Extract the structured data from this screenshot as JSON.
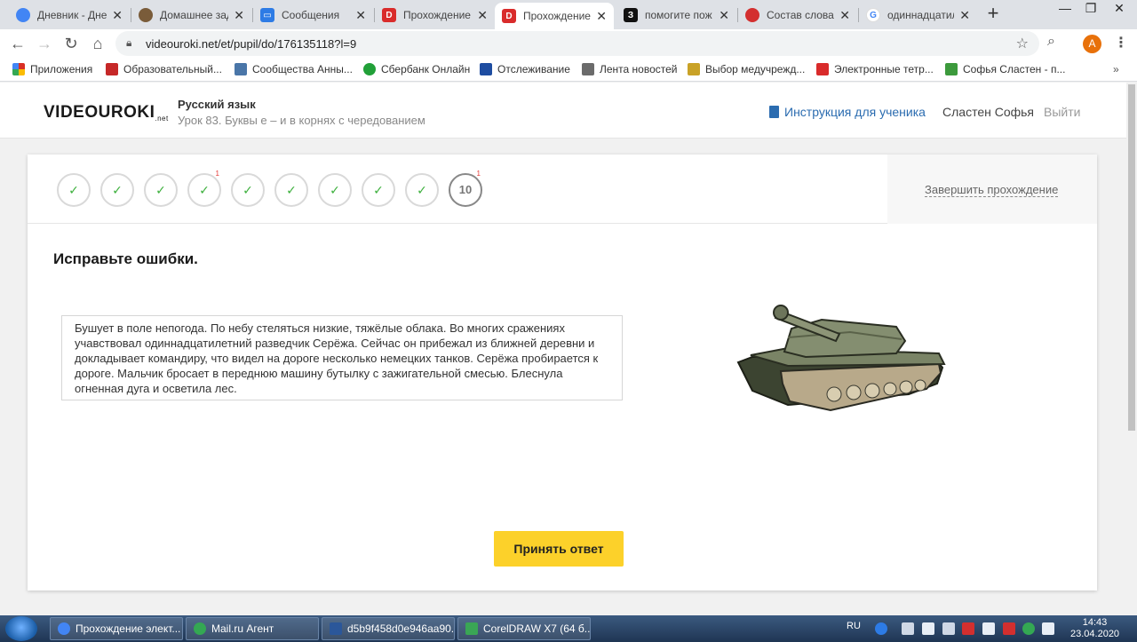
{
  "browser": {
    "tabs": [
      {
        "title": "Дневник - Дне",
        "icon": "chrome-icon",
        "color": "#4285f4"
      },
      {
        "title": "Домашнее зад",
        "icon": "owl-icon",
        "color": "#7a5c3a"
      },
      {
        "title": "Сообщения",
        "icon": "chat-icon",
        "color": "#2d7be5"
      },
      {
        "title": "Прохождение",
        "icon": "videouroki-icon",
        "color": "#d92b2b"
      },
      {
        "title": "Прохождение",
        "icon": "videouroki-icon",
        "color": "#d92b2b",
        "active": true
      },
      {
        "title": "помогите пож",
        "icon": "znanija-icon",
        "color": "#111111"
      },
      {
        "title": "Состав слова",
        "icon": "red-circle-icon",
        "color": "#d32f2f"
      },
      {
        "title": "одиннадцатил",
        "icon": "google-icon",
        "color": "#4285f4"
      }
    ],
    "new_tab": "+",
    "window_controls": {
      "minimize": "—",
      "maximize": "❐",
      "close": "✕"
    },
    "url": "videouroki.net/et/pupil/do/176135118?l=9",
    "profile_initial": "A",
    "profile_color": "#e8710a"
  },
  "bookmarks": [
    {
      "label": "Приложения",
      "icon": "apps-grid-icon",
      "color": "#d93025"
    },
    {
      "label": "Образовательный...",
      "icon": "bookmark-icon",
      "color": "#c62828"
    },
    {
      "label": "Сообщества Анны...",
      "icon": "vk-icon",
      "color": "#4a76a8"
    },
    {
      "label": "Сбербанк Онлайн",
      "icon": "sberbank-icon",
      "color": "#21a038"
    },
    {
      "label": "Отслеживание",
      "icon": "emblem-icon",
      "color": "#1e4da1"
    },
    {
      "label": "Лента новостей",
      "icon": "news-icon",
      "color": "#6b6b6b"
    },
    {
      "label": "Выбор медучрежд...",
      "icon": "medical-icon",
      "color": "#c9a227"
    },
    {
      "label": "Электронные тетр...",
      "icon": "videouroki-icon",
      "color": "#d92b2b"
    },
    {
      "label": "Софья Сластен - п...",
      "icon": "book-icon",
      "color": "#3c9a3c"
    }
  ],
  "header": {
    "logo": "VIDEOUROKI",
    "logo_suffix": ".net",
    "subject": "Русский язык",
    "lesson": "Урок 83. Буквы е – и в корнях с чередованием",
    "instruction_link": "Инструкция для ученика",
    "username": "Сластен Софья",
    "logout": "Выйти",
    "accent_color": "#2b6cb0"
  },
  "progress": {
    "steps": [
      {
        "label": "✓",
        "flag": ""
      },
      {
        "label": "✓",
        "flag": ""
      },
      {
        "label": "✓",
        "flag": ""
      },
      {
        "label": "✓",
        "flag": "1"
      },
      {
        "label": "✓",
        "flag": ""
      },
      {
        "label": "✓",
        "flag": ""
      },
      {
        "label": "✓",
        "flag": ""
      },
      {
        "label": "✓",
        "flag": ""
      },
      {
        "label": "✓",
        "flag": ""
      },
      {
        "label": "10",
        "flag": "1",
        "current": true
      }
    ],
    "finish_link": "Завершить прохождение",
    "check_color": "#3db03d"
  },
  "task": {
    "title": "Исправьте ошибки.",
    "text": "Бушует в поле непогода. По небу стеляться низкие, тяжёлые облака. Во многих сражениях учавствовал одиннадцатилетний разведчик Серёжа. Сейчас он прибежал из ближней деревни и докладывает командиру, что видел на дороге несколько немецких танков. Серёжа пробирается к дороге. Мальчик бросает в переднюю машину бутылку с зажигательной смесью. Блеснула огненная дуга и осветила лес.",
    "image": "tank-icon",
    "submit": "Принять ответ",
    "submit_color": "#fcd12a"
  },
  "taskbar": {
    "buttons": [
      {
        "label": "Прохождение элект...",
        "icon": "chrome-icon",
        "color": "#4285f4"
      },
      {
        "label": "Mail.ru Агент",
        "icon": "mailru-agent-icon",
        "color": "#34a853"
      },
      {
        "label": "d5b9f458d0e946aa90...",
        "icon": "word-icon",
        "color": "#2b579a"
      },
      {
        "label": "CorelDRAW X7 (64 б...",
        "icon": "coreldraw-icon",
        "color": "#3aa655"
      }
    ],
    "language": "RU",
    "time": "14:43",
    "date": "23.04.2020"
  }
}
